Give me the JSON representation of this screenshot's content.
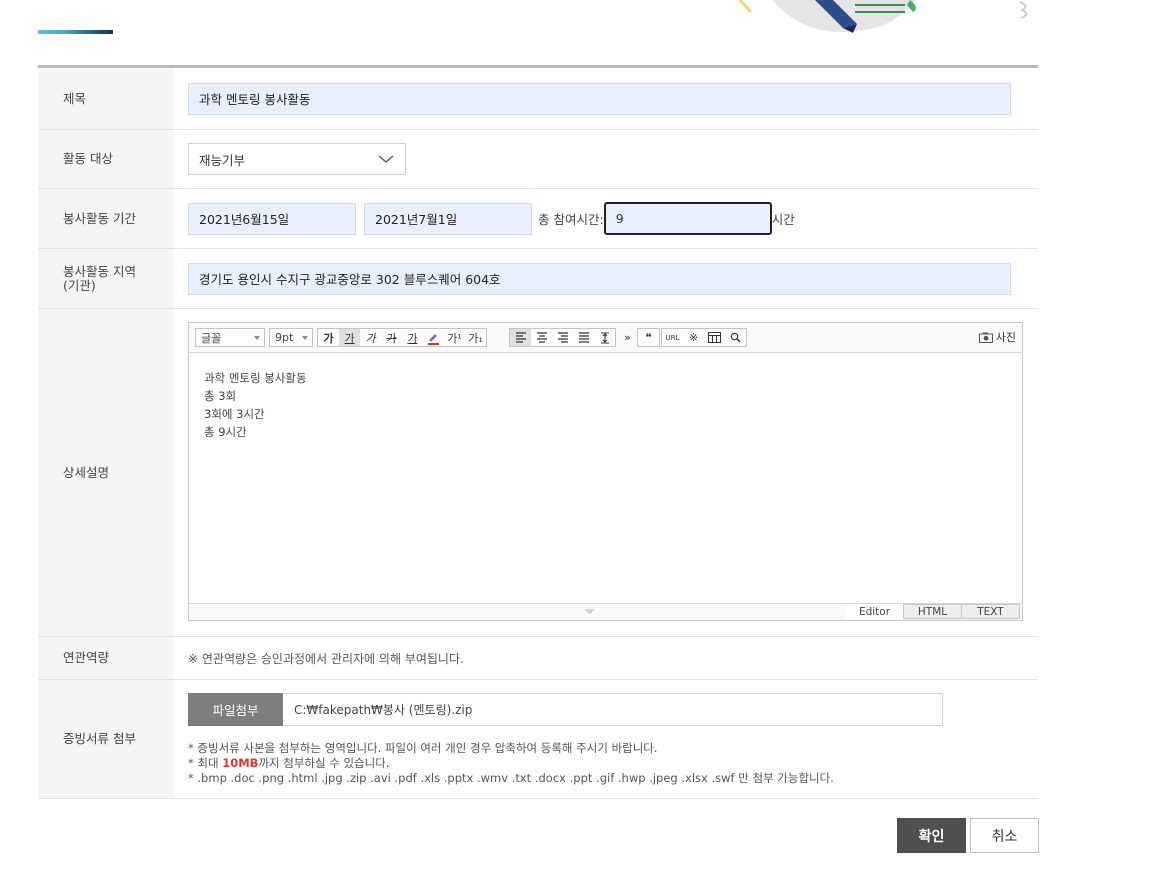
{
  "form": {
    "title": {
      "label": "제목",
      "value": "과학 멘토링 봉사활동"
    },
    "target": {
      "label": "활동 대상",
      "selected": "재능기부"
    },
    "period": {
      "label": "봉사활동 기간",
      "start": "2021년6월15일",
      "end": "2021년7월1일",
      "total_label": "총 참여시간:",
      "hours": "9",
      "unit": "시간"
    },
    "region": {
      "label_line1": "봉사활동 지역",
      "label_line2": "(기관)",
      "value": "경기도 용인시 수지구 광교중앙로 302 블루스퀘어 604호"
    },
    "description": {
      "label": "상세설명",
      "toolbar": {
        "font": "글꼴",
        "size": "9pt",
        "bold": "가",
        "underline": "가",
        "italic": "가",
        "strike": "가",
        "fontcolor": "가",
        "sup": "가¹",
        "sub": "가₁",
        "more": "»",
        "quote": "❝",
        "url": "URL",
        "special": "※",
        "photo": "사진"
      },
      "lines": [
        "과학 멘토링 봉사활동",
        "총 3회",
        "3회에 3시간",
        "총 9시간"
      ],
      "tabs": [
        "Editor",
        "HTML",
        "TEXT"
      ]
    },
    "competency": {
      "label": "연관역량",
      "note": "※ 연관역량은 승인과정에서 관리자에 의해 부여됩니다."
    },
    "file": {
      "label": "증빙서류 첨부",
      "button": "파일첨부",
      "path": "C:₩fakepath₩봉사 (멘토링).zip",
      "note1": "* 증빙서류 사본을 첨부하는 영역입니다. 파일이 여러 개인 경우 압축하여 등록해 주시기 바랍니다.",
      "note2_pre": "* 최대 ",
      "note2_size": "10MB",
      "note2_post": "까지 첨부하실 수 있습니다.",
      "note3": "* .bmp .doc .png .html .jpg .zip .avi .pdf .xls .pptx .wmv .txt .docx .ppt .gif .hwp .jpeg .xlsx .swf 만 첨부 가능합니다."
    }
  },
  "actions": {
    "confirm": "확인",
    "cancel": "취소"
  },
  "colors": {
    "input_bg": "#e8f0fe",
    "header_bg": "#f5f5f5",
    "confirm_bg": "#4f4f4f",
    "file_btn": "#7d7d7d",
    "accent_red": "#e5342c"
  }
}
